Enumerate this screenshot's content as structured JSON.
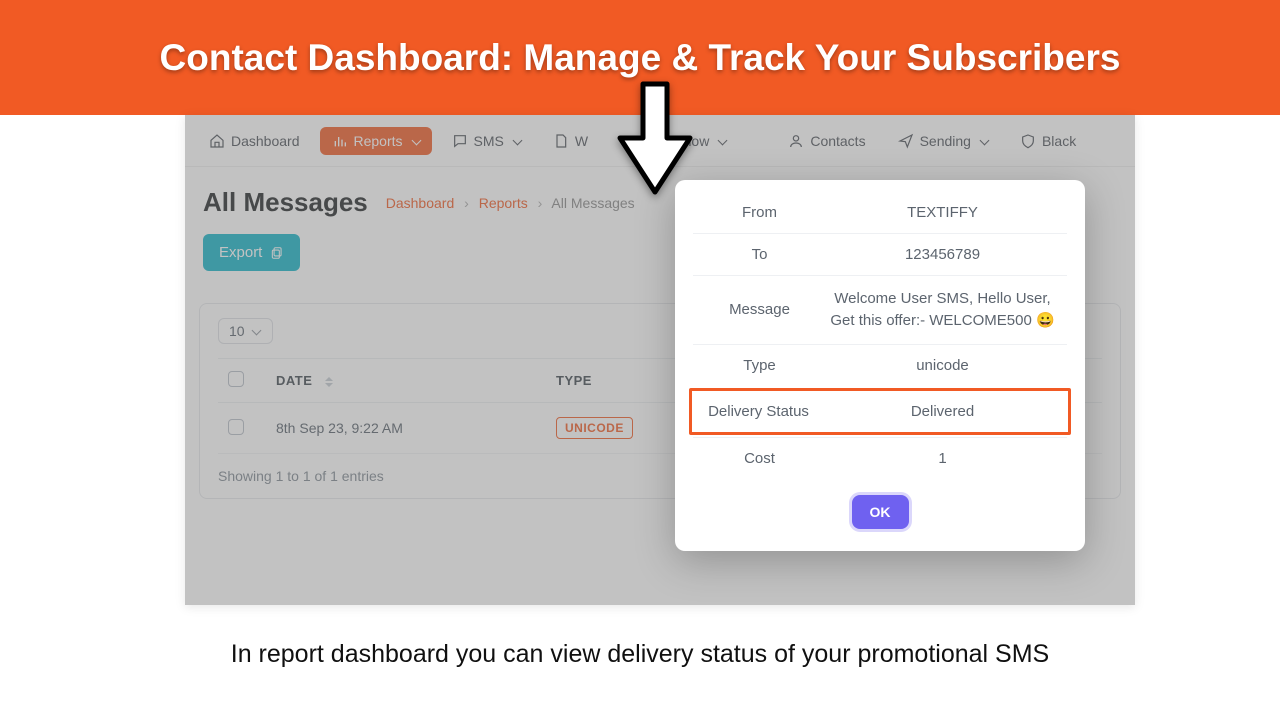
{
  "banner_title": "Contact Dashboard: Manage & Track Your Subscribers",
  "nav": {
    "dashboard": "Dashboard",
    "reports": "Reports",
    "sms": "SMS",
    "flow_a": "W",
    "flow_b": "p Flow",
    "contacts": "Contacts",
    "sending": "Sending",
    "black": "Black"
  },
  "page": {
    "title": "All Messages",
    "crumb_dashboard": "Dashboard",
    "crumb_reports": "Reports",
    "crumb_current": "All Messages"
  },
  "export_label": "Export",
  "page_size": "10",
  "table": {
    "col_date": "DATE",
    "col_type": "TYPE",
    "row1_date": "8th Sep 23, 9:22 AM",
    "row1_type": "UNICODE"
  },
  "entries_text": "Showing 1 to 1 of 1 entries",
  "modal": {
    "from_l": "From",
    "from_v": "TEXTIFFY",
    "to_l": "To",
    "to_v": "123456789",
    "msg_l": "Message",
    "msg_v": "Welcome User SMS, Hello User, Get this offer:- WELCOME500 😀",
    "type_l": "Type",
    "type_v": "unicode",
    "status_l": "Delivery Status",
    "status_v": "Delivered",
    "cost_l": "Cost",
    "cost_v": "1",
    "ok": "OK"
  },
  "caption": "In report dashboard you can view delivery status of your promotional SMS"
}
